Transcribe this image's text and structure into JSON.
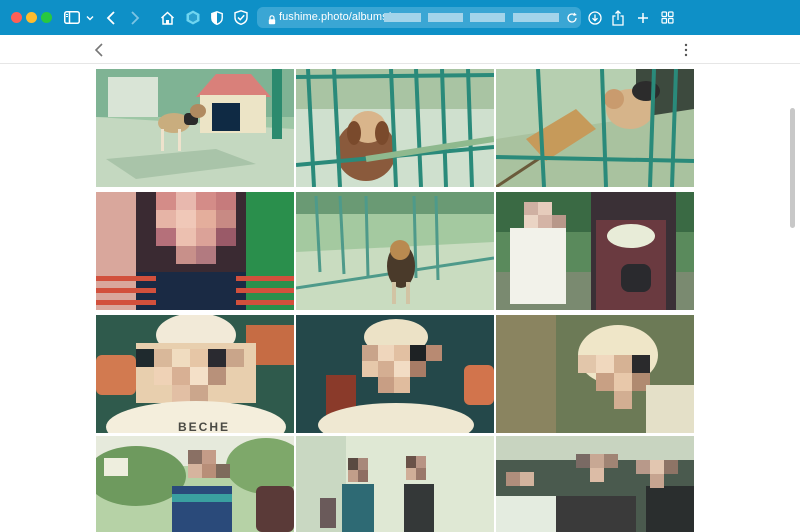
{
  "browser": {
    "url": "fushime.photo/albums/",
    "tab_overview_label": "tab overview"
  },
  "album": {
    "photos": [
      {
        "name": "photo-beagle-doghouse",
        "alt": "beagle beside doghouse"
      },
      {
        "name": "photo-beagle-fence",
        "alt": "beagle behind fence"
      },
      {
        "name": "photo-beagle-broom",
        "alt": "beagle and broom"
      },
      {
        "name": "photo-child-striped-shirt",
        "alt": "child in striped shirt"
      },
      {
        "name": "photo-dog-garden-fence",
        "alt": "dog at garden fence"
      },
      {
        "name": "photo-child-and-adult",
        "alt": "child and adult"
      },
      {
        "name": "photo-baby-bonnet-1",
        "alt": "baby in bonnet"
      },
      {
        "name": "photo-baby-bonnet-2",
        "alt": "baby in bonnet"
      },
      {
        "name": "photo-baby-bonnet-3",
        "alt": "baby in bonnet"
      },
      {
        "name": "photo-person-outdoors",
        "alt": "person outdoors"
      },
      {
        "name": "photo-two-people",
        "alt": "two people standing"
      },
      {
        "name": "photo-group",
        "alt": "group of people"
      }
    ]
  },
  "print_text": "BECHE"
}
